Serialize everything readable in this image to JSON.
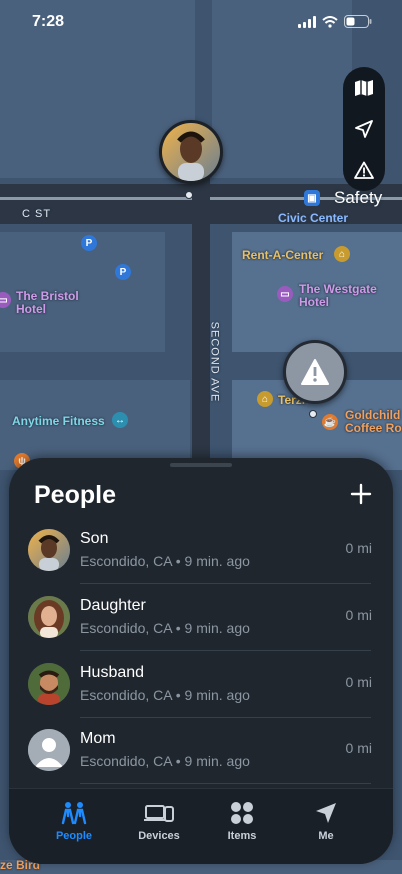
{
  "status": {
    "time": "7:28"
  },
  "map": {
    "street_c": "C ST",
    "street_second": "SECOND AVE",
    "places": {
      "civic_center": "Civic Center",
      "rent_a_center": "Rent-A-Center",
      "bristol_l1": "The Bristol",
      "bristol_l2": "Hotel",
      "westgate_l1": "The Westgate",
      "westgate_l2": "Hotel",
      "anytime_fitness": "Anytime Fitness",
      "terzi": "Terzi",
      "goldchild_l1": "Goldchild",
      "goldchild_l2": "Coffee Ro",
      "bottom_left": "ze Bird"
    },
    "safety_label": "Safety"
  },
  "sheet": {
    "title": "People",
    "people": [
      {
        "name": "Son",
        "location": "Escondido, CA • 9 min. ago",
        "distance": "0 mi"
      },
      {
        "name": "Daughter",
        "location": "Escondido, CA • 9 min. ago",
        "distance": "0 mi"
      },
      {
        "name": "Husband",
        "location": "Escondido, CA • 9 min. ago",
        "distance": "0 mi"
      },
      {
        "name": "Mom",
        "location": "Escondido, CA • 9 min. ago",
        "distance": "0 mi"
      }
    ]
  },
  "tabs": [
    {
      "label": "People",
      "icon": "people-icon",
      "active": true
    },
    {
      "label": "Devices",
      "icon": "devices-icon",
      "active": false
    },
    {
      "label": "Items",
      "icon": "items-icon",
      "active": false
    },
    {
      "label": "Me",
      "icon": "location-arrow-icon",
      "active": false
    }
  ],
  "colors": {
    "accent": "#1e8bff",
    "sheet_bg": "#1f262e",
    "map_bg": "#3e546f"
  }
}
